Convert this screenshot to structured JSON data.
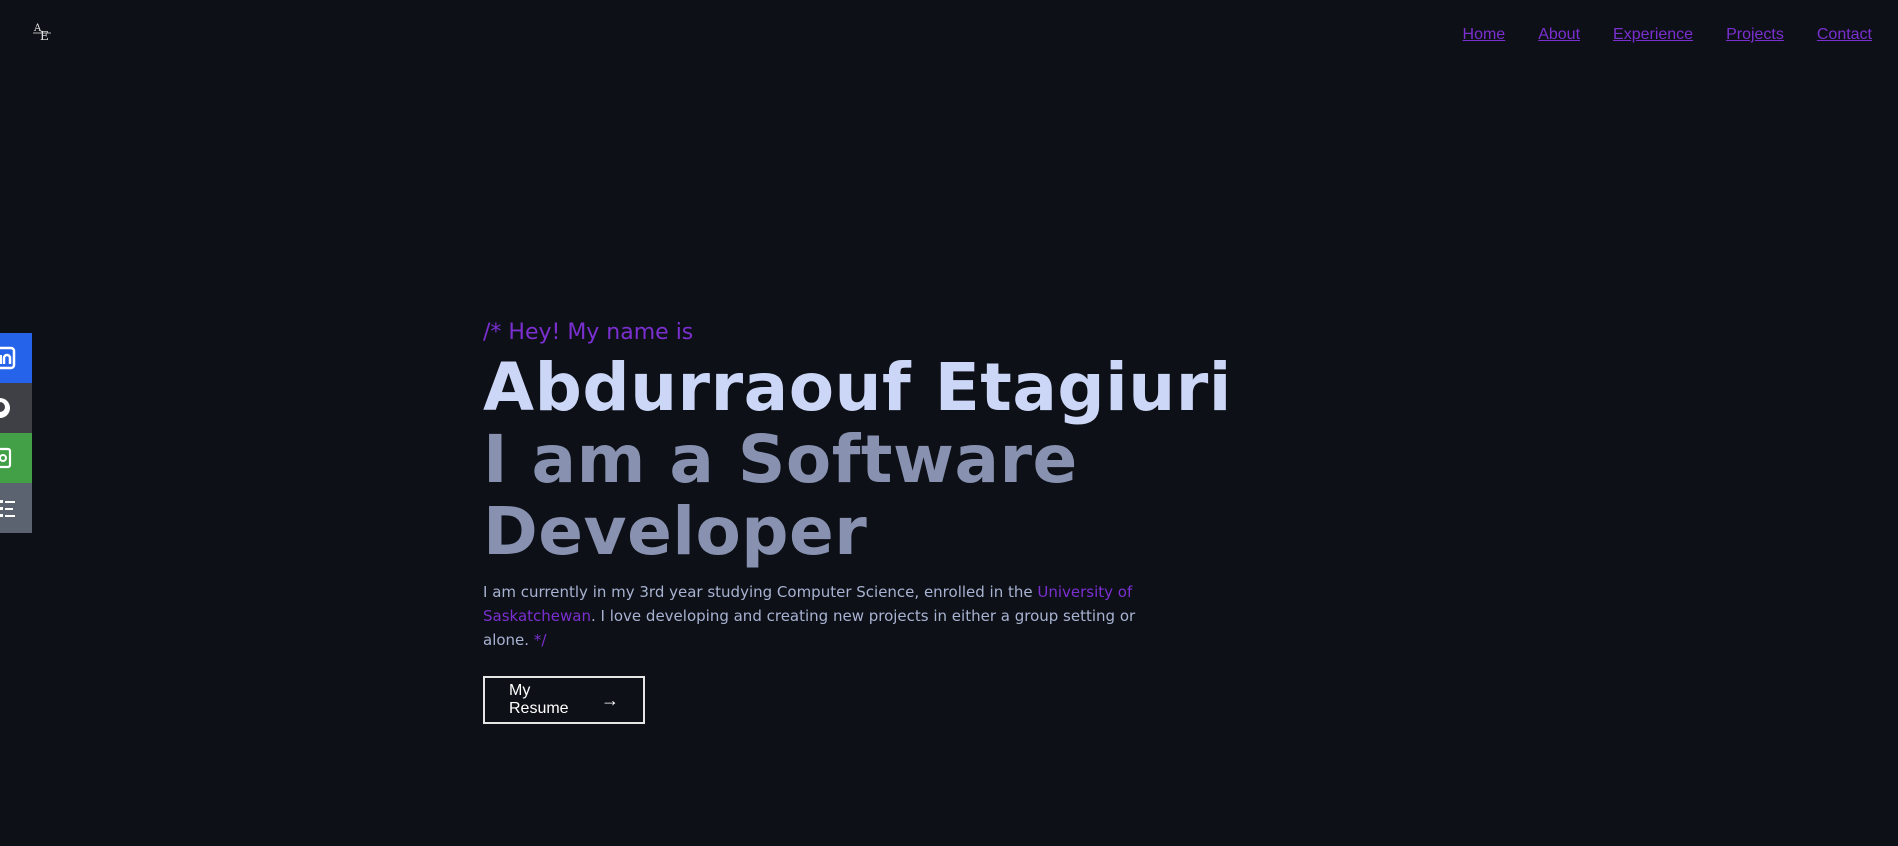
{
  "nav": {
    "items": [
      {
        "label": "Home"
      },
      {
        "label": "About"
      },
      {
        "label": "Experience"
      },
      {
        "label": "Projects"
      },
      {
        "label": "Contact"
      }
    ]
  },
  "social": {
    "items": [
      {
        "name": "linkedin",
        "icon": "linkedin-icon",
        "color": "#2563eb"
      },
      {
        "name": "github",
        "icon": "github-icon",
        "color": "#3f3f46"
      },
      {
        "name": "email",
        "icon": "email-icon",
        "color": "#43a047"
      },
      {
        "name": "resume",
        "icon": "resume-icon",
        "color": "#5b6270"
      }
    ]
  },
  "hero": {
    "intro": "/* Hey! My name is",
    "name": "Abdurraouf Etagiuri",
    "role": "I am a Software Developer",
    "desc_prefix": "I am currently in my 3rd year studying Computer Science, enrolled in the ",
    "desc_link": "University of Saskatchewan",
    "desc_suffix": ". I love developing and creating new projects in either a group setting or alone. ",
    "desc_close": "*/",
    "resume_button": "My Resume"
  },
  "colors": {
    "background": "#0d1017",
    "accent": "#7b2fd0",
    "heading": "#ccd6f6",
    "subheading": "#8892b0",
    "body_text": "#a8b2d1"
  }
}
